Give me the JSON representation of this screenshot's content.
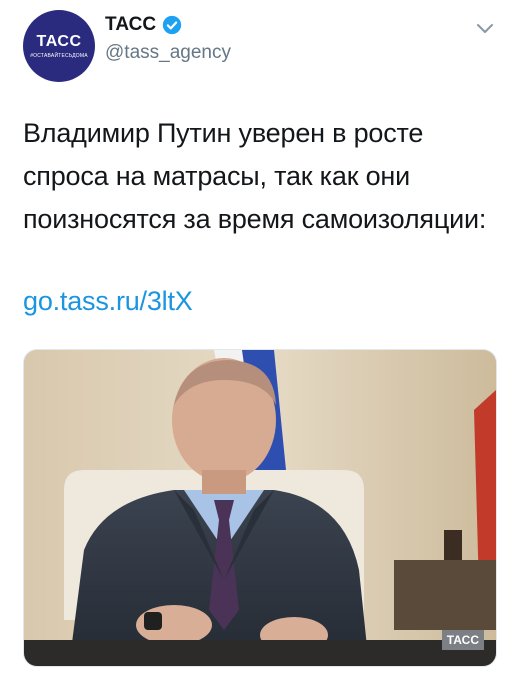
{
  "account": {
    "avatar_logo": "ТАСС",
    "avatar_tagline": "#ОСТАВАЙТЕСЬДОМА",
    "display_name": "ТАСС",
    "handle": "@tass_agency",
    "verified": true
  },
  "tweet": {
    "text": "Владимир Путин уверен в росте спроса на матрасы, так как они поизносятся за время самоизоляции:",
    "link": "go.tass.ru/3ltX"
  },
  "media": {
    "watermark": "ТАСС"
  },
  "colors": {
    "avatar_bg": "#2a2b7e",
    "link": "#1b95e0",
    "verified": "#1da1f2",
    "secondary_text": "#657786"
  },
  "icons": {
    "verified": "verified-badge-icon",
    "more": "chevron-down-icon"
  }
}
